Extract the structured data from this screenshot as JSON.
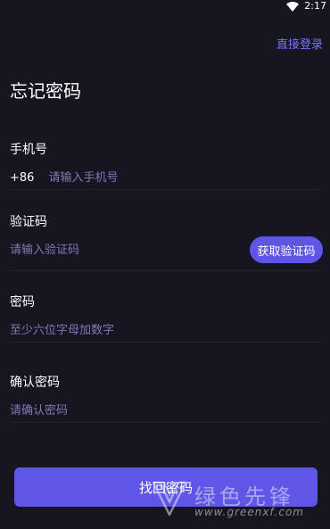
{
  "status_bar": {
    "time": "2:17",
    "wifi_icon": "wifi-icon"
  },
  "header": {
    "direct_login_label": "直接登录",
    "title": "忘记密码"
  },
  "phone": {
    "label": "手机号",
    "country_code": "+86",
    "placeholder": "请输入手机号",
    "value": ""
  },
  "verification": {
    "label": "验证码",
    "placeholder": "请输入验证码",
    "value": "",
    "get_code_label": "获取验证码"
  },
  "password": {
    "label": "密码",
    "placeholder": "至少六位字母加数字",
    "value": ""
  },
  "confirm_password": {
    "label": "确认密码",
    "placeholder": "请确认密码",
    "value": ""
  },
  "submit_label": "找回密码",
  "watermark": {
    "text": "绿色先锋",
    "url": "www.greenxf.com",
    "logo_icon": "greenxf-logo-icon"
  },
  "colors": {
    "background": "#17151f",
    "accent": "#5f55e6",
    "link": "#7b73ff",
    "placeholder": "#7d7ab5",
    "divider": "#25222f"
  }
}
